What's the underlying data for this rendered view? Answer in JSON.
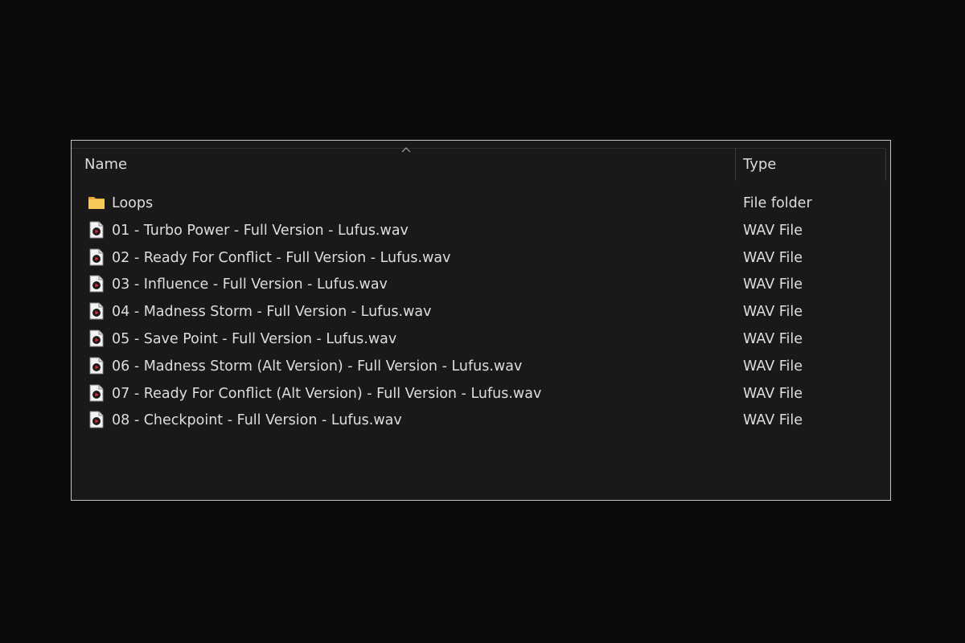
{
  "columns": {
    "name": "Name",
    "type": "Type"
  },
  "sort": {
    "column": "Name",
    "direction": "ascending"
  },
  "items": [
    {
      "name": "Loops",
      "type": "File folder",
      "icon": "folder-icon"
    },
    {
      "name": "01 - Turbo Power - Full Version - Lufus.wav",
      "type": "WAV File",
      "icon": "wav-file-icon"
    },
    {
      "name": "02 - Ready For Conflict - Full Version - Lufus.wav",
      "type": "WAV File",
      "icon": "wav-file-icon"
    },
    {
      "name": "03 - Influence - Full Version - Lufus.wav",
      "type": "WAV File",
      "icon": "wav-file-icon"
    },
    {
      "name": "04 - Madness Storm - Full Version - Lufus.wav",
      "type": "WAV File",
      "icon": "wav-file-icon"
    },
    {
      "name": "05 - Save Point - Full Version - Lufus.wav",
      "type": "WAV File",
      "icon": "wav-file-icon"
    },
    {
      "name": "06 - Madness Storm (Alt Version) - Full Version - Lufus.wav",
      "type": "WAV File",
      "icon": "wav-file-icon"
    },
    {
      "name": "07 - Ready For Conflict (Alt Version) - Full Version - Lufus.wav",
      "type": "WAV File",
      "icon": "wav-file-icon"
    },
    {
      "name": "08 - Checkpoint - Full Version - Lufus.wav",
      "type": "WAV File",
      "icon": "wav-file-icon"
    }
  ],
  "colors": {
    "background": "#0b0b0b",
    "panel": "#191919",
    "text": "#dedede",
    "folder": "#f2c14e",
    "media_accent": "#c8102e"
  }
}
